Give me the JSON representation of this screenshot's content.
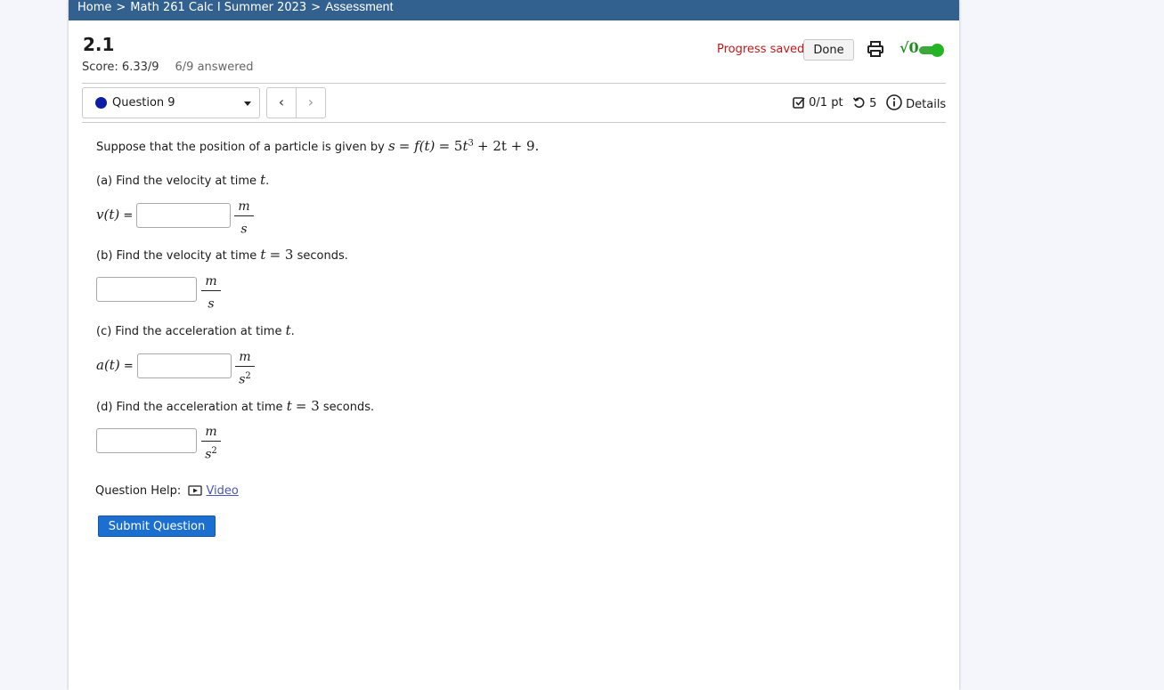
{
  "breadcrumb": {
    "home": "Home",
    "course": "Math 261 Calc I Summer 2023",
    "current": "Assessment",
    "separator": ">"
  },
  "assignment": {
    "title": "2.1",
    "score": "Score: 6.33/9",
    "answered": "6/9 answered"
  },
  "header": {
    "progress_saved": "Progress saved",
    "done_label": "Done",
    "sqrt_label": "√0"
  },
  "question_nav": {
    "selected_question": "Question 9",
    "prev_label": "‹",
    "next_label": "›"
  },
  "meta": {
    "points": "0/1 pt",
    "attempts": "5",
    "details": "Details"
  },
  "question": {
    "intro": "Suppose that the position of a particle is given by",
    "equation": {
      "lhs": "s",
      "f": "f(t)",
      "rhs_coef": "5",
      "rhs_var": "t",
      "rhs_exp": "3",
      "rhs_rest": "+ 2t + 9."
    },
    "part_a": {
      "text": "(a) Find the velocity at time",
      "var": "t",
      "end": ".",
      "lhs": "v(t)",
      "eq": "=",
      "value": "",
      "unit_num": "m",
      "unit_den": "s",
      "unit_exp": ""
    },
    "part_b": {
      "text": "(b) Find the velocity at time",
      "var": "t",
      "cond": "= 3",
      "end": "seconds.",
      "value": "",
      "unit_num": "m",
      "unit_den": "s",
      "unit_exp": ""
    },
    "part_c": {
      "text": "(c) Find the acceleration at time",
      "var": "t",
      "end": ".",
      "lhs": "a(t)",
      "eq": "=",
      "value": "",
      "unit_num": "m",
      "unit_den": "s",
      "unit_exp": "2"
    },
    "part_d": {
      "text": "(d) Find the acceleration at time",
      "var": "t",
      "cond": "= 3",
      "end": "seconds.",
      "value": "",
      "unit_num": "m",
      "unit_den": "s",
      "unit_exp": "2"
    }
  },
  "help": {
    "label": "Question Help:",
    "video": "Video"
  },
  "submit_label": "Submit Question",
  "colors": {
    "topbar": "#33618f",
    "saved_text": "#c01818",
    "submit": "#1a6fd1",
    "toggle": "#23b523",
    "question_dot": "#0c1ea6",
    "link": "#4a56b8"
  }
}
